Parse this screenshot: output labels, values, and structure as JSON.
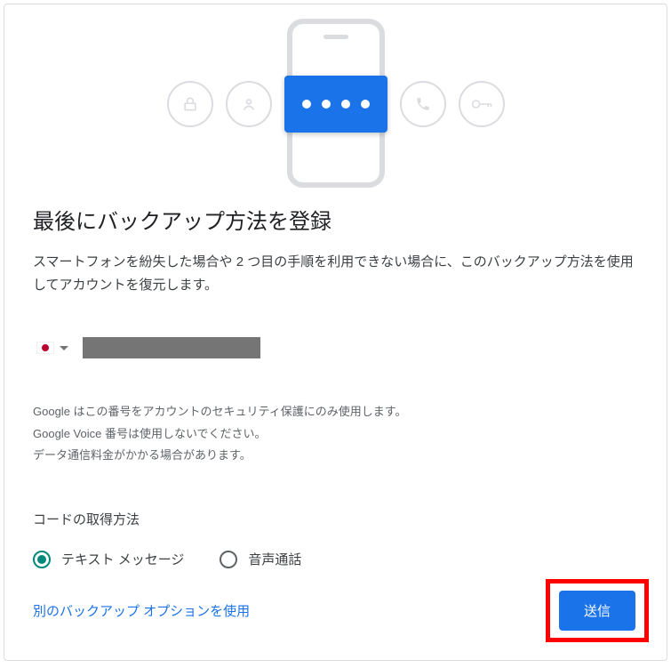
{
  "heading": "最後にバックアップ方法を登録",
  "description": "スマートフォンを紛失した場合や 2 つ目の手順を利用できない場合に、このバックアップ方法を使用してアカウントを復元します。",
  "phone_value": "██████████",
  "disclaimer": {
    "line1": "Google はこの番号をアカウントのセキュリティ保護にのみ使用します。",
    "line2": "Google Voice 番号は使用しないでください。",
    "line3": "データ通信料金がかかる場合があります。"
  },
  "code_method_label": "コードの取得方法",
  "radio": {
    "text_message": "テキスト メッセージ",
    "voice_call": "音声通話"
  },
  "alt_option": "別のバックアップ オプションを使用",
  "submit": "送信"
}
